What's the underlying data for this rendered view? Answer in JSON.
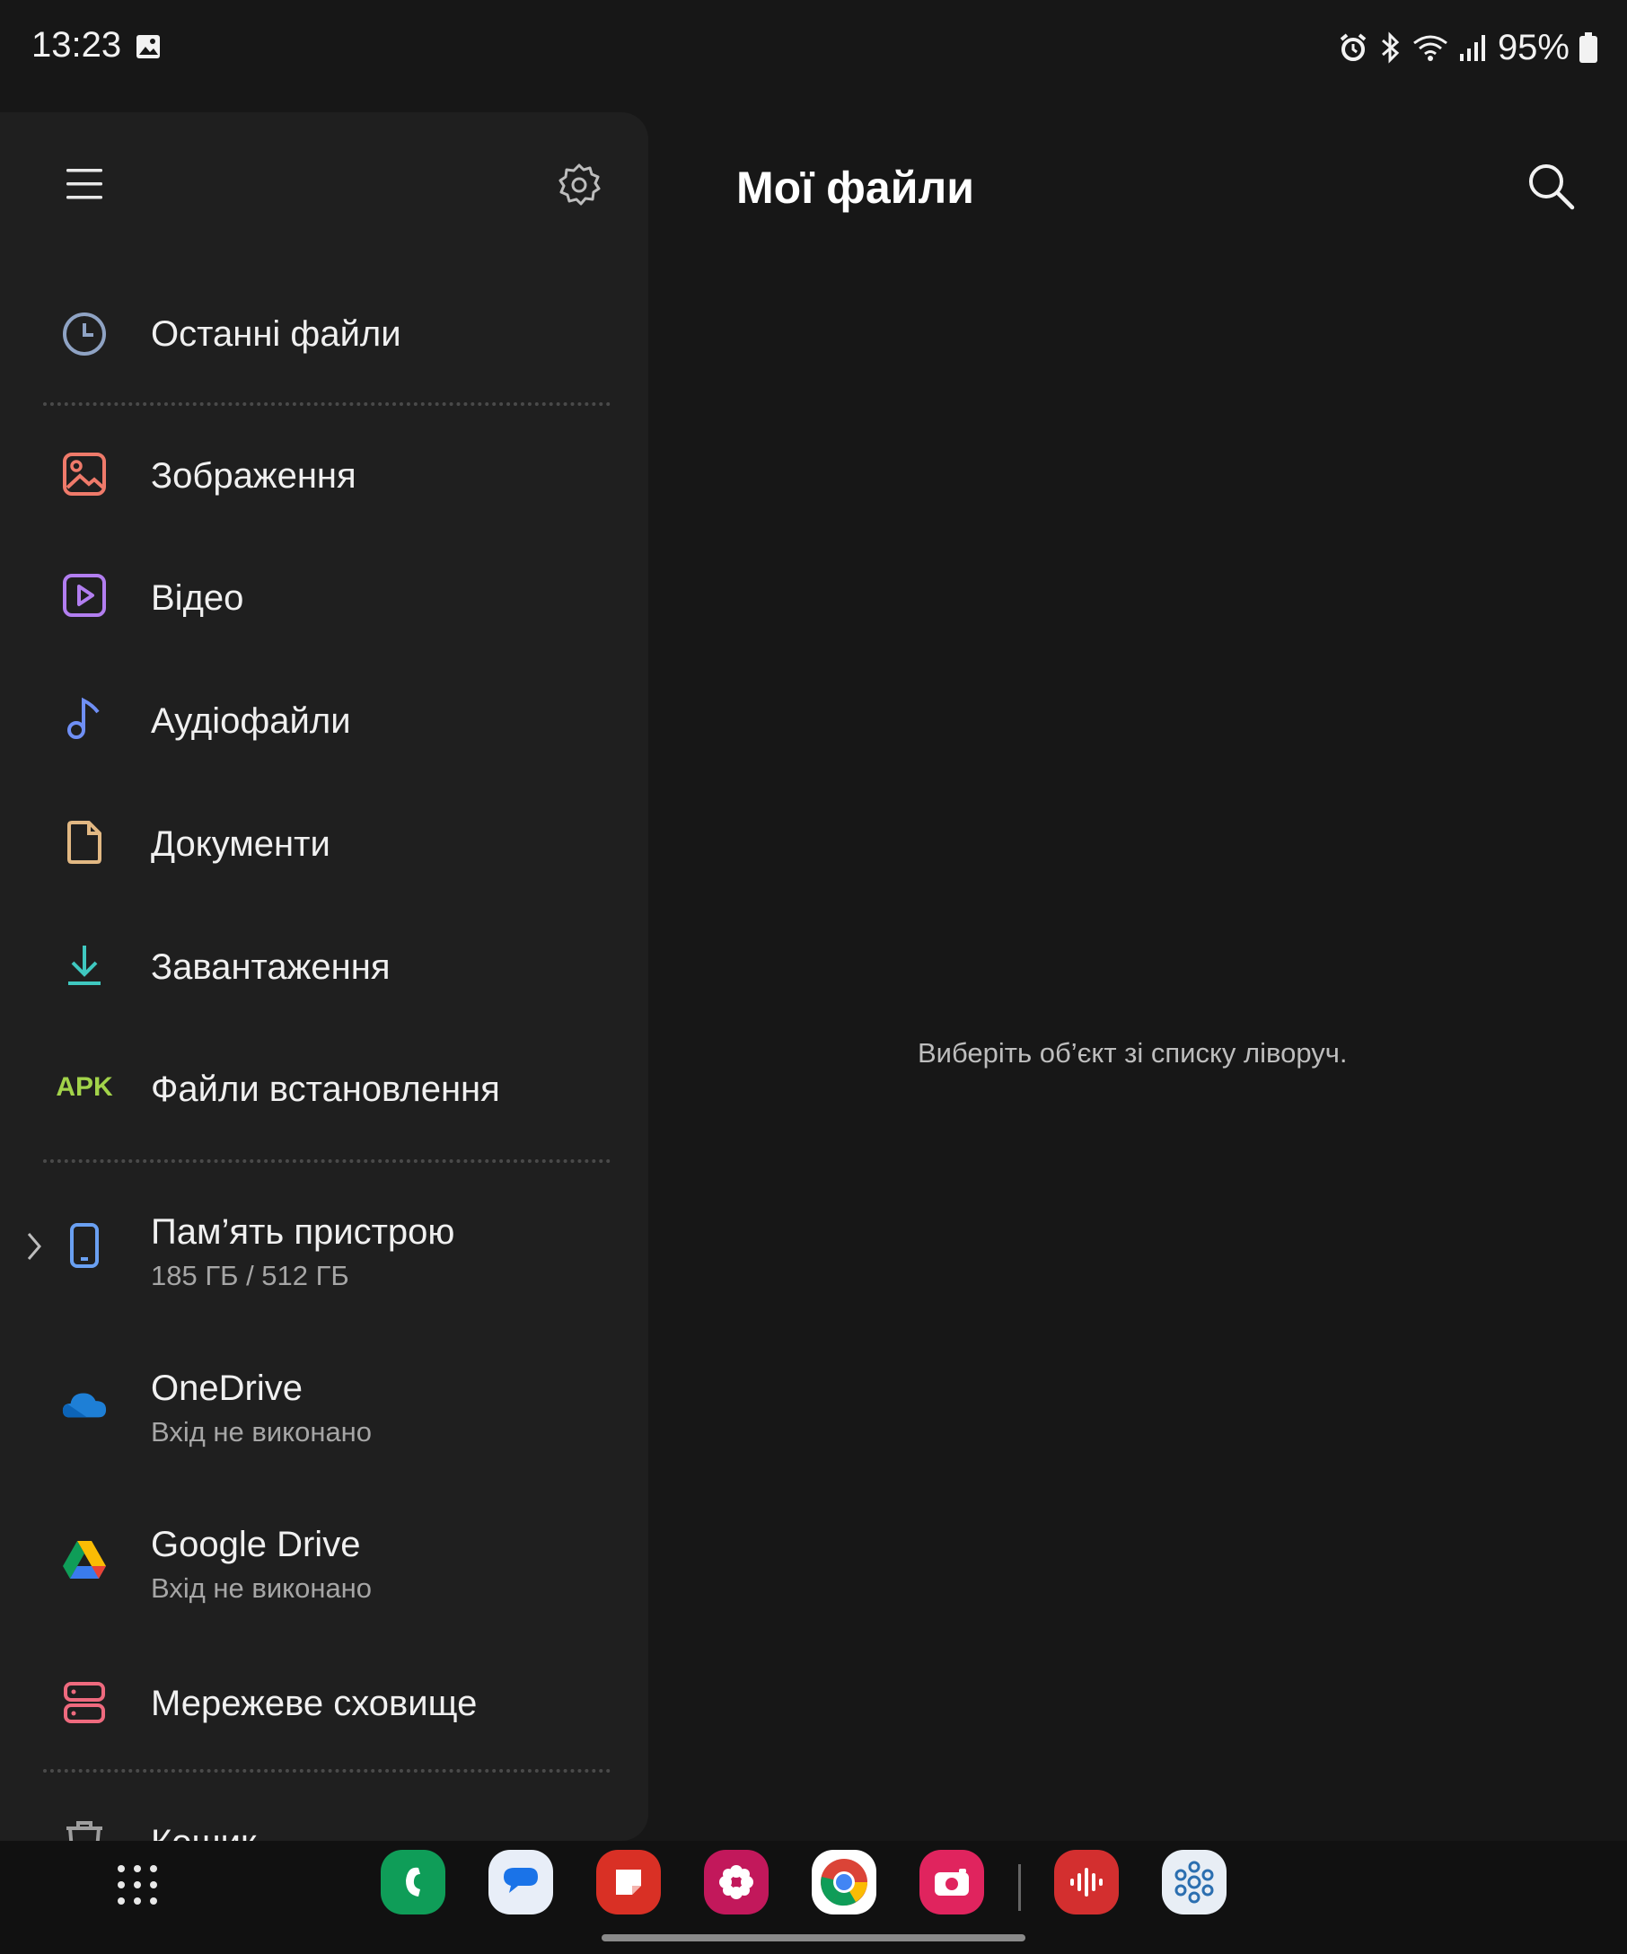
{
  "status_bar": {
    "time": "13:23",
    "battery": "95%",
    "icons": [
      "gallery-notification-icon",
      "alarm-icon",
      "bluetooth-icon",
      "wifi-icon",
      "signal-icon",
      "battery-icon"
    ]
  },
  "side_panel": {
    "menu_icon": "hamburger-menu-icon",
    "settings_icon": "gear-icon",
    "items": [
      {
        "label": "Останні файли",
        "icon": "clock-icon",
        "color": "#8fa3c4"
      },
      {
        "label": "Зображення",
        "icon": "image-icon",
        "color": "#ef7a6a"
      },
      {
        "label": "Відео",
        "icon": "video-icon",
        "color": "#b27ef0"
      },
      {
        "label": "Аудіофайли",
        "icon": "music-note-icon",
        "color": "#6f8ff5"
      },
      {
        "label": "Документи",
        "icon": "document-icon",
        "color": "#e2b883"
      },
      {
        "label": "Завантаження",
        "icon": "download-icon",
        "color": "#3fc8c0"
      },
      {
        "label": "Файли встановлення",
        "icon": "apk-icon",
        "icon_text": "APK",
        "color": "#a2d34a"
      }
    ],
    "storage": [
      {
        "label": "Пам’ять пристрою",
        "sub": "185 ГБ / 512 ГБ",
        "icon": "phone-icon",
        "color": "#6aa0f2"
      },
      {
        "label": "OneDrive",
        "sub": "Вхід не виконано",
        "icon": "onedrive-icon",
        "color": "#1e7fd6"
      },
      {
        "label": "Google Drive",
        "sub": "Вхід не виконано",
        "icon": "google-drive-icon"
      },
      {
        "label": "Мережеве сховище",
        "icon": "network-storage-icon",
        "color": "#ee6a7e"
      }
    ],
    "trash": {
      "label": "Кошик",
      "icon": "trash-icon"
    }
  },
  "main": {
    "title": "Мої файли",
    "search_icon": "search-icon",
    "empty_message": "Виберіть об’єкт зі списку ліворуч."
  },
  "dock": {
    "apps": [
      {
        "name": "apps-grid-icon"
      },
      {
        "name": "phone-app-icon",
        "color": "#0f9d58"
      },
      {
        "name": "messages-app-icon",
        "color": "#e8eef8"
      },
      {
        "name": "notes-app-icon",
        "color": "#d93025"
      },
      {
        "name": "gallery-app-icon",
        "color": "#c2185b"
      },
      {
        "name": "chrome-app-icon",
        "color": "#ffffff"
      },
      {
        "name": "camera-app-icon",
        "color": "#e0245e"
      },
      {
        "name": "voice-recorder-app-icon",
        "color": "#d32f2f"
      },
      {
        "name": "smartthings-app-icon",
        "color": "#e8eef5"
      }
    ]
  }
}
